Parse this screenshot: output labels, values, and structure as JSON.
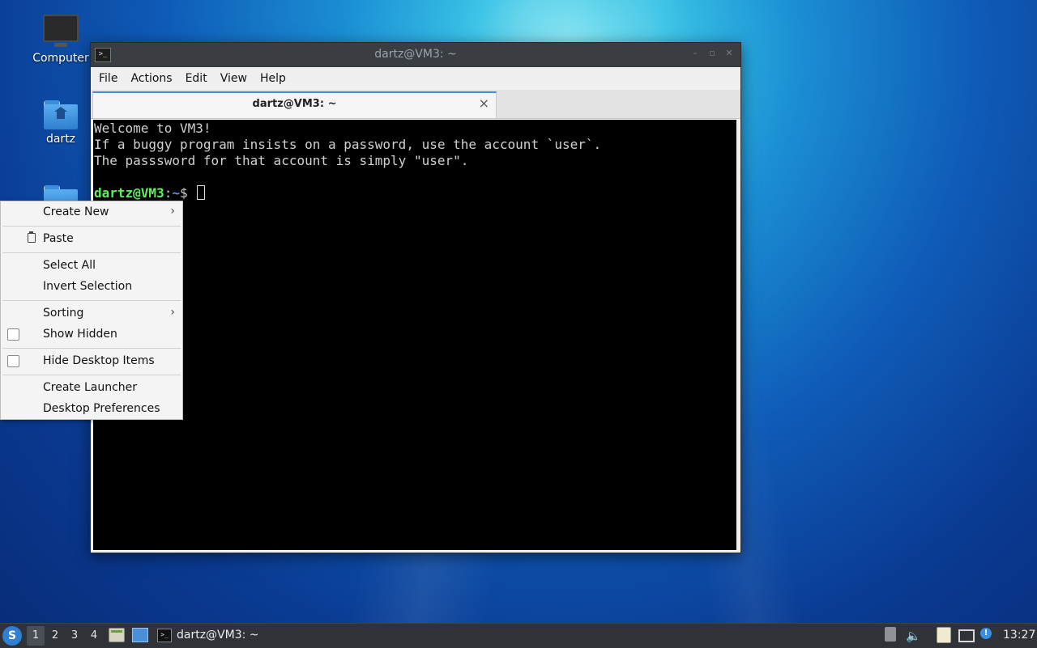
{
  "desktop": {
    "icons": [
      {
        "label": "Computer",
        "icon": "computer-icon"
      },
      {
        "label": "dartz",
        "icon": "home-folder-icon"
      }
    ]
  },
  "window": {
    "title": "dartz@VM3: ~",
    "menu": [
      "File",
      "Actions",
      "Edit",
      "View",
      "Help"
    ],
    "tab_title": "dartz@VM3: ~",
    "tab_close": "×"
  },
  "terminal": {
    "lines": [
      "Welcome to VM3!",
      "If a buggy program insists on a password, use the account `user`.",
      "The passsword for that account is simply \"user\"."
    ],
    "prompt_user": "dartz@VM3",
    "prompt_sep": ":",
    "prompt_path": "~",
    "prompt_symbol": "$ ",
    "colors": {
      "background": "#000000",
      "text": "#d0d0d0",
      "user": "#5ff05f",
      "path": "#5c8ef5"
    }
  },
  "context_menu": {
    "create_new": "Create New",
    "paste": "Paste",
    "select_all": "Select All",
    "invert_selection": "Invert Selection",
    "sorting": "Sorting",
    "show_hidden": "Show Hidden",
    "hide_desktop_items": "Hide Desktop Items",
    "create_launcher": "Create Launcher",
    "desktop_preferences": "Desktop Preferences",
    "submenu_arrow": "›"
  },
  "taskbar": {
    "workspaces": [
      "1",
      "2",
      "3",
      "4"
    ],
    "active_workspace": "1",
    "task_label": "dartz@VM3: ~",
    "clock": "13:27",
    "accent": "#2f7fd3"
  }
}
